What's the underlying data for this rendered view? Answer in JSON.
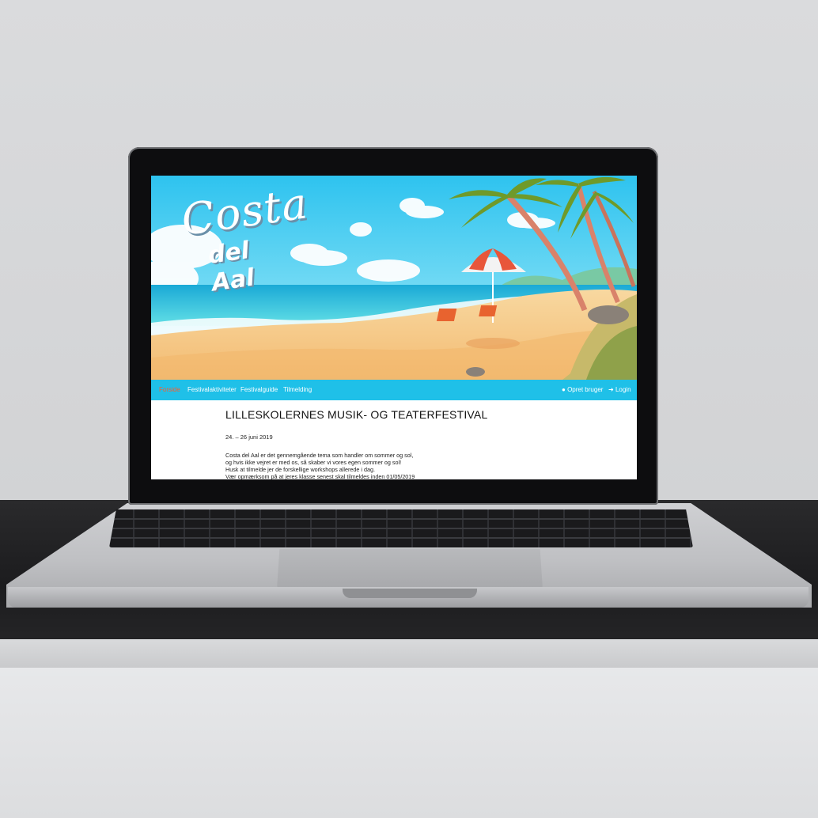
{
  "site": {
    "logo_line1": "Costa",
    "logo_line2": "del Aal"
  },
  "nav": {
    "left_items": [
      {
        "label": "Forside",
        "active": true
      },
      {
        "label": "Festivalaktiviteter",
        "active": false
      },
      {
        "label": "Festivalguide",
        "active": false
      },
      {
        "label": "Tilmelding",
        "active": false
      }
    ],
    "right_items": [
      {
        "label": "Opret bruger",
        "icon": "user-icon"
      },
      {
        "label": "Login",
        "icon": "login-icon"
      }
    ]
  },
  "main": {
    "title": "LILLESKOLERNES MUSIK- OG TEATERFESTIVAL",
    "dates": "24. – 26 juni 2019",
    "body_lines": [
      "Costa del Aal er det gennemgående tema som handler om sommer og sol,",
      "og hvis ikke vejret er med os, så skaber vi vores egen sommer og sol!",
      "Husk at tilmelde jer de forskellige workshops allerede i dag.",
      "Vær opmærksom på at jeres klasse senest skal tilmeldes inden 01/05/2019"
    ]
  },
  "colors": {
    "nav_bg": "#1fc0e8",
    "nav_active": "#ff5a2a",
    "sky": "#4fd0f2",
    "sand": "#f6c987"
  }
}
